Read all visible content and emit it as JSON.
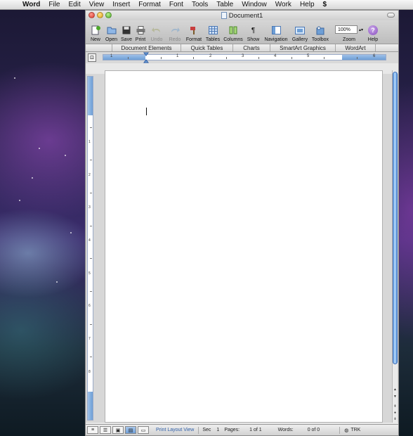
{
  "menubar": {
    "apple_glyph": "",
    "items": [
      "Word",
      "File",
      "Edit",
      "View",
      "Insert",
      "Format",
      "Font",
      "Tools",
      "Table",
      "Window",
      "Work",
      "Help"
    ],
    "script_glyph": "$"
  },
  "window": {
    "title": "Document1"
  },
  "toolbar": {
    "new": "New",
    "open": "Open",
    "save": "Save",
    "print": "Print",
    "undo": "Undo",
    "redo": "Redo",
    "format": "Format",
    "tables": "Tables",
    "columns": "Columns",
    "show": "Show",
    "navigation": "Navigation",
    "gallery": "Gallery",
    "toolbox": "Toolbox",
    "zoom_value": "100%",
    "zoom": "Zoom",
    "help": "Help",
    "help_glyph": "?",
    "show_glyph": "¶"
  },
  "ribbon": {
    "tabs": [
      "Document Elements",
      "Quick Tables",
      "Charts",
      "SmartArt Graphics",
      "WordArt"
    ]
  },
  "ruler": {
    "h_numbers": [
      "1",
      "1",
      "2",
      "3",
      "4",
      "5",
      "6"
    ],
    "v_numbers": [
      "1",
      "2",
      "3",
      "4",
      "5",
      "6",
      "7",
      "8"
    ]
  },
  "statusbar": {
    "view_label": "Print Layout View",
    "sec_label": "Sec",
    "sec_value": "1",
    "pages_label": "Pages:",
    "pages_value": "1 of 1",
    "words_label": "Words:",
    "words_value": "0 of 0",
    "trk_label": "TRK"
  },
  "colors": {
    "accent": "#6e9fd6",
    "scroll_thumb": "#6ea6e6"
  }
}
